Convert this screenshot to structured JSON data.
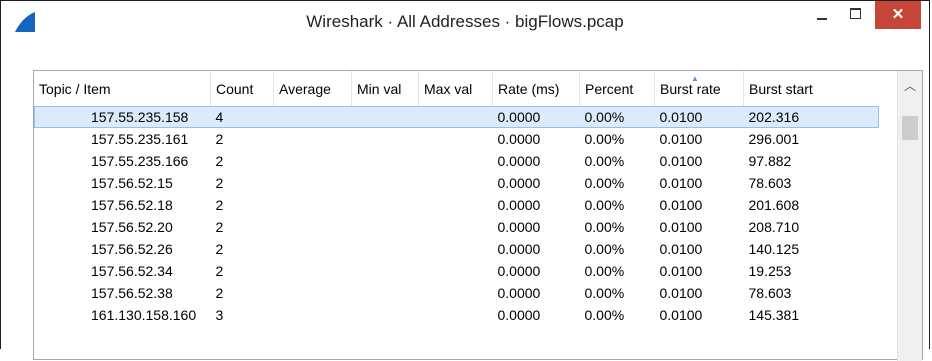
{
  "window": {
    "title": "Wireshark · All Addresses · bigFlows.pcap",
    "close_label": "✕"
  },
  "table": {
    "headers": [
      "Topic / Item",
      "Count",
      "Average",
      "Min val",
      "Max val",
      "Rate (ms)",
      "Percent",
      "Burst rate",
      "Burst start"
    ],
    "sorted_column": "Burst rate",
    "rows": [
      {
        "item": "157.55.235.158",
        "count": "4",
        "average": "",
        "min": "",
        "max": "",
        "rate": "0.0000",
        "percent": "0.00%",
        "burst_rate": "0.0100",
        "burst_start": "202.316"
      },
      {
        "item": "157.55.235.161",
        "count": "2",
        "average": "",
        "min": "",
        "max": "",
        "rate": "0.0000",
        "percent": "0.00%",
        "burst_rate": "0.0100",
        "burst_start": "296.001"
      },
      {
        "item": "157.55.235.166",
        "count": "2",
        "average": "",
        "min": "",
        "max": "",
        "rate": "0.0000",
        "percent": "0.00%",
        "burst_rate": "0.0100",
        "burst_start": "97.882"
      },
      {
        "item": "157.56.52.15",
        "count": "2",
        "average": "",
        "min": "",
        "max": "",
        "rate": "0.0000",
        "percent": "0.00%",
        "burst_rate": "0.0100",
        "burst_start": "78.603"
      },
      {
        "item": "157.56.52.18",
        "count": "2",
        "average": "",
        "min": "",
        "max": "",
        "rate": "0.0000",
        "percent": "0.00%",
        "burst_rate": "0.0100",
        "burst_start": "201.608"
      },
      {
        "item": "157.56.52.20",
        "count": "2",
        "average": "",
        "min": "",
        "max": "",
        "rate": "0.0000",
        "percent": "0.00%",
        "burst_rate": "0.0100",
        "burst_start": "208.710"
      },
      {
        "item": "157.56.52.26",
        "count": "2",
        "average": "",
        "min": "",
        "max": "",
        "rate": "0.0000",
        "percent": "0.00%",
        "burst_rate": "0.0100",
        "burst_start": "140.125"
      },
      {
        "item": "157.56.52.34",
        "count": "2",
        "average": "",
        "min": "",
        "max": "",
        "rate": "0.0000",
        "percent": "0.00%",
        "burst_rate": "0.0100",
        "burst_start": "19.253"
      },
      {
        "item": "157.56.52.38",
        "count": "2",
        "average": "",
        "min": "",
        "max": "",
        "rate": "0.0000",
        "percent": "0.00%",
        "burst_rate": "0.0100",
        "burst_start": "78.603"
      },
      {
        "item": "161.130.158.160",
        "count": "3",
        "average": "",
        "min": "",
        "max": "",
        "rate": "0.0000",
        "percent": "0.00%",
        "burst_rate": "0.0100",
        "burst_start": "145.381"
      }
    ],
    "selected_index": 0
  },
  "scrollbar": {
    "up_icon": "chevron-up-icon"
  }
}
